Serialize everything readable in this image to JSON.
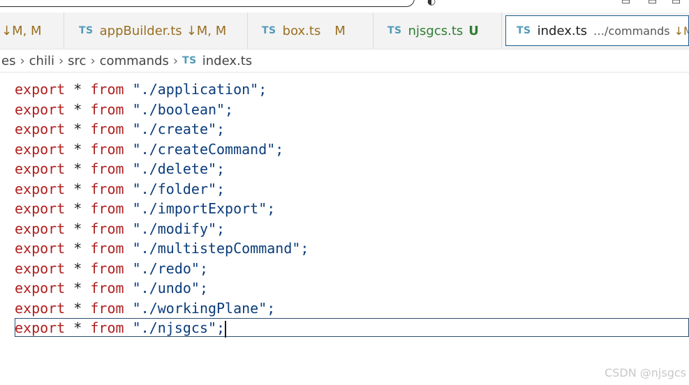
{
  "tabs": [
    {
      "id": "partial",
      "name": "",
      "status": "↓M, M",
      "kind": "modified",
      "active": false
    },
    {
      "id": "appbuilder",
      "icon": "TS",
      "name": "appBuilder.ts",
      "status": "↓M, M",
      "kind": "modified",
      "active": false
    },
    {
      "id": "box",
      "icon": "TS",
      "name": "box.ts",
      "status": "M",
      "kind": "modified",
      "active": false
    },
    {
      "id": "njsgcs",
      "icon": "TS",
      "name": "njsgcs.ts",
      "status": "U",
      "kind": "untracked",
      "active": false
    },
    {
      "id": "index",
      "icon": "TS",
      "name": "index.ts",
      "dir": "…/commands",
      "status": "↓M",
      "kind": "active",
      "active": true
    }
  ],
  "breadcrumb": {
    "items": [
      "es",
      "chili",
      "src",
      "commands"
    ],
    "file_icon": "TS",
    "file": "index.ts"
  },
  "code": {
    "keyword_export": "export",
    "operator": "*",
    "keyword_from": "from",
    "lines": [
      "\"./application\";",
      "\"./boolean\";",
      "\"./create\";",
      "\"./createCommand\";",
      "\"./delete\";",
      "\"./folder\";",
      "\"./importExport\";",
      "\"./modify\";",
      "\"./multistepCommand\";",
      "\"./redo\";",
      "\"./undo\";",
      "\"./workingPlane\";",
      "\"./njsgcs\";"
    ]
  },
  "watermark": "CSDN @njsgcs",
  "colors": {
    "keyword": "#af1f1f",
    "string": "#0a3c7a",
    "modified": "#9b6e20",
    "untracked": "#2e7d32",
    "ts_icon": "#519aba",
    "active_border": "#1f5f8b"
  }
}
